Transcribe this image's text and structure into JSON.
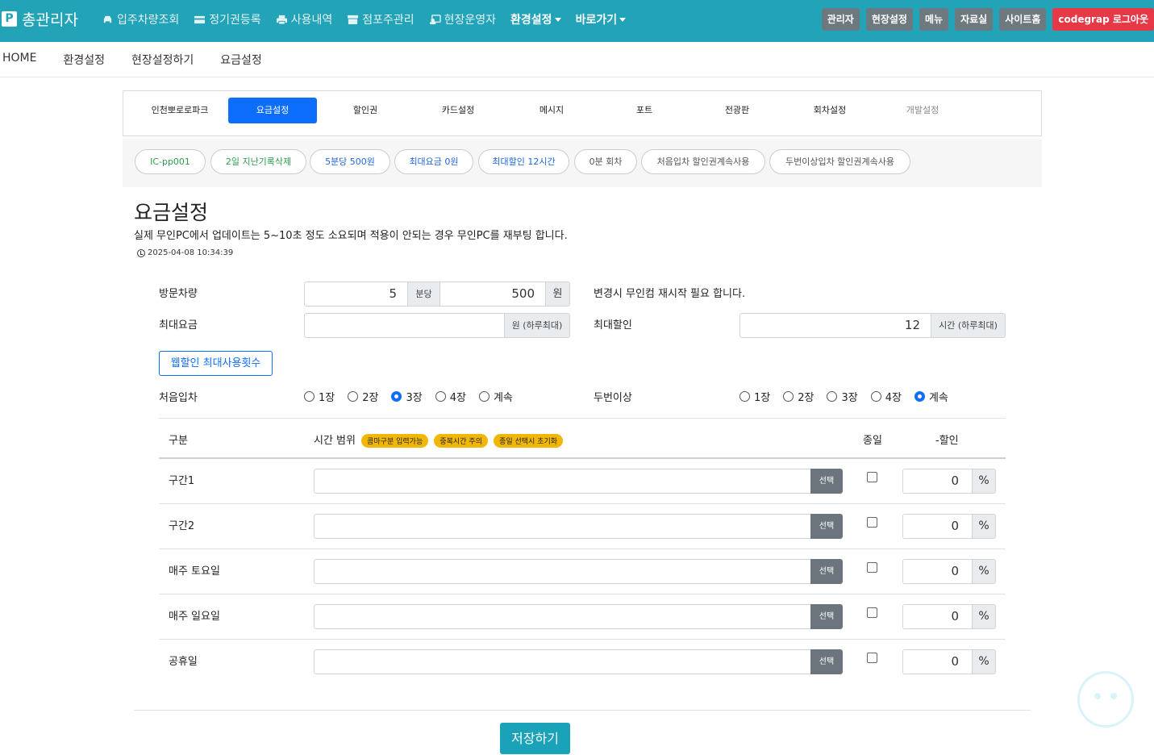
{
  "navbar": {
    "brand": "총관리자",
    "brand_logo": "P",
    "items": [
      {
        "label": "입주차량조회",
        "icon": "car-icon"
      },
      {
        "label": "정기권등록",
        "icon": "card-icon"
      },
      {
        "label": "사용내역",
        "icon": "print-icon"
      },
      {
        "label": "점포주관리",
        "icon": "store-icon"
      },
      {
        "label": "현장운영자",
        "icon": "user-icon"
      }
    ],
    "dropdowns": [
      "환경설정",
      "바로가기"
    ],
    "right_buttons": [
      "관리자",
      "현장설정",
      "메뉴",
      "자료실",
      "사이트홈"
    ],
    "logout": "codegrap 로그아웃",
    "colors": {
      "bar": "#22a3b7",
      "logout": "#e63846"
    }
  },
  "breadcrumb": [
    "HOME",
    "환경설정",
    "현장설정하기",
    "요금설정"
  ],
  "tabs": [
    "인천뽀로로파크",
    "요금설정",
    "할인권",
    "카드설정",
    "메시지",
    "포트",
    "전광판",
    "회차설정",
    "개발설정"
  ],
  "chips": [
    "IC-pp001",
    "2일 지난기록삭제",
    "5분당 500원",
    "최대요금 0원",
    "최대할인 12시간",
    "0분 회차",
    "처음입차 할인권계속사용",
    "두번이상입차 할인권계속사용"
  ],
  "title": "요금설정",
  "notice": "실제 무인PC에서 업데이트는 5~10초 정도 소요되며 적용이 안되는 경우 무인PC를 재부팅 합니다.",
  "timestamp": "2025-04-08 10:34:39",
  "form": {
    "visit_label": "방문차량",
    "visit_minutes": "5",
    "visit_minutes_unit": "분당",
    "visit_amount": "500",
    "visit_amount_unit": "원",
    "restart_note": "변경시 무인컴 재시작 필요 합니다.",
    "max_fee_label": "최대요금",
    "max_fee_value": "",
    "max_fee_unit": "원 (하루최대)",
    "max_discount_label": "최대할인",
    "max_discount_value": "12",
    "max_discount_unit": "시간 (하루최대)",
    "web_discount_button": "웹할인 최대사용횟수",
    "first_entry_label": "처음입차",
    "repeat_entry_label": "두번이상",
    "radio_options": [
      "1장",
      "2장",
      "3장",
      "4장",
      "계속"
    ],
    "first_entry_selected": "3장",
    "repeat_entry_selected": "계속"
  },
  "table": {
    "headers": {
      "category": "구분",
      "time_range": "시간 범위",
      "all_day": "종일",
      "discount": "-할인"
    },
    "badges": [
      "콤마구분 입력가능",
      "중복시간 주의",
      "종일 선택시 초기화"
    ],
    "select_label": "선택",
    "percent_label": "%",
    "rows": [
      {
        "label": "구간1",
        "range": "",
        "all_day": false,
        "discount": "0"
      },
      {
        "label": "구간2",
        "range": "",
        "all_day": false,
        "discount": "0"
      },
      {
        "label": "매주 토요일",
        "range": "",
        "all_day": false,
        "discount": "0"
      },
      {
        "label": "매주 일요일",
        "range": "",
        "all_day": false,
        "discount": "0"
      },
      {
        "label": "공휴일",
        "range": "",
        "all_day": false,
        "discount": "0"
      }
    ]
  },
  "save_button": "저장하기"
}
